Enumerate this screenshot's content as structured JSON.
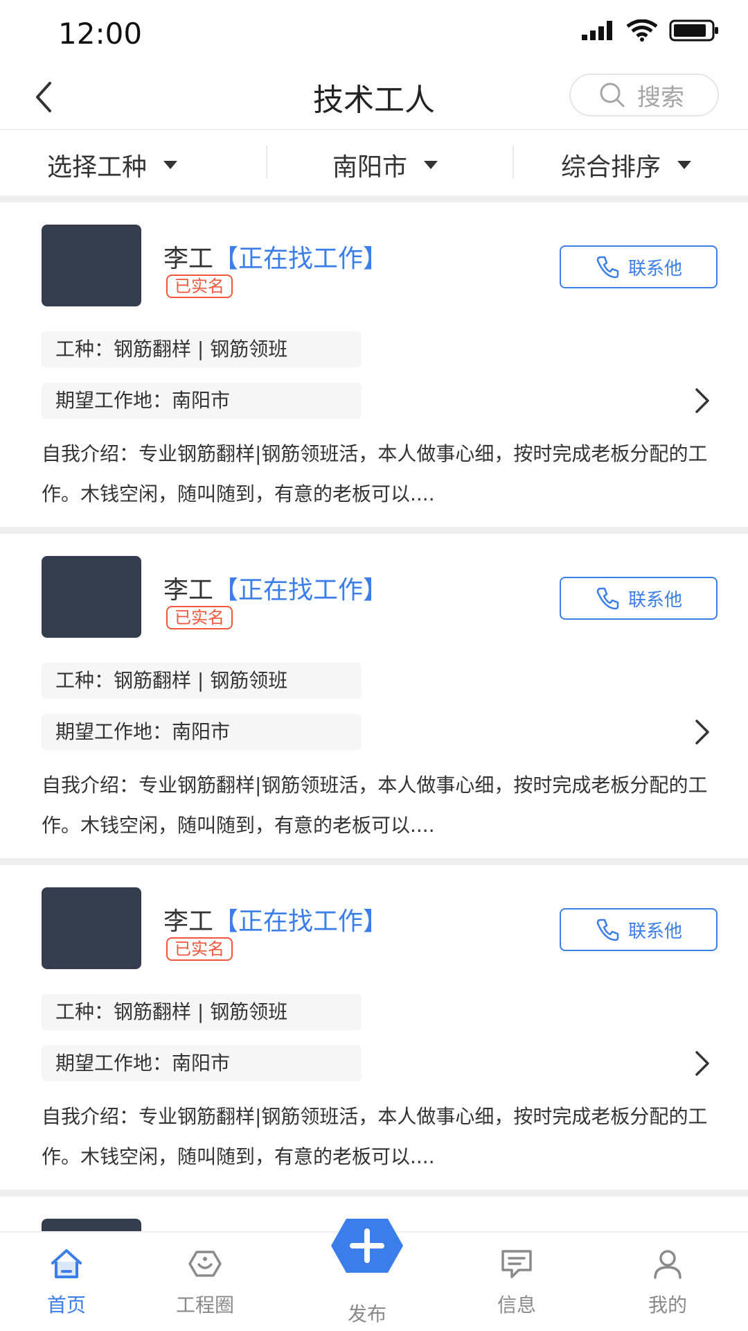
{
  "status_bar": {
    "time": "12:00"
  },
  "header": {
    "title": "技术工人",
    "search_placeholder": "搜索"
  },
  "filters": [
    {
      "label": "选择工种"
    },
    {
      "label": "南阳市"
    },
    {
      "label": "综合排序"
    }
  ],
  "workers": [
    {
      "name": "李工",
      "status": "【正在找工作】",
      "verified": "已实名",
      "contact": "联系他",
      "work_type": "工种：钢筋翻样 | 钢筋领班",
      "location": "期望工作地：南阳市",
      "intro": "自我介绍：专业钢筋翻样|钢筋领班活，本人做事心细，按时完成老板分配的工作。木钱空闲，随叫随到，有意的老板可以...."
    },
    {
      "name": "李工",
      "status": "【正在找工作】",
      "verified": "已实名",
      "contact": "联系他",
      "work_type": "工种：钢筋翻样 | 钢筋领班",
      "location": "期望工作地：南阳市",
      "intro": "自我介绍：专业钢筋翻样|钢筋领班活，本人做事心细，按时完成老板分配的工作。木钱空闲，随叫随到，有意的老板可以...."
    },
    {
      "name": "李工",
      "status": "【正在找工作】",
      "verified": "已实名",
      "contact": "联系他",
      "work_type": "工种：钢筋翻样 | 钢筋领班",
      "location": "期望工作地：南阳市",
      "intro": "自我介绍：专业钢筋翻样|钢筋领班活，本人做事心细，按时完成老板分配的工作。木钱空闲，随叫随到，有意的老板可以...."
    }
  ],
  "tabbar": {
    "home": "首页",
    "circle": "工程圈",
    "publish": "发布",
    "messages": "信息",
    "mine": "我的"
  },
  "colors": {
    "accent": "#3b7de9",
    "verified": "#f0563b",
    "avatar": "#343c4d"
  }
}
